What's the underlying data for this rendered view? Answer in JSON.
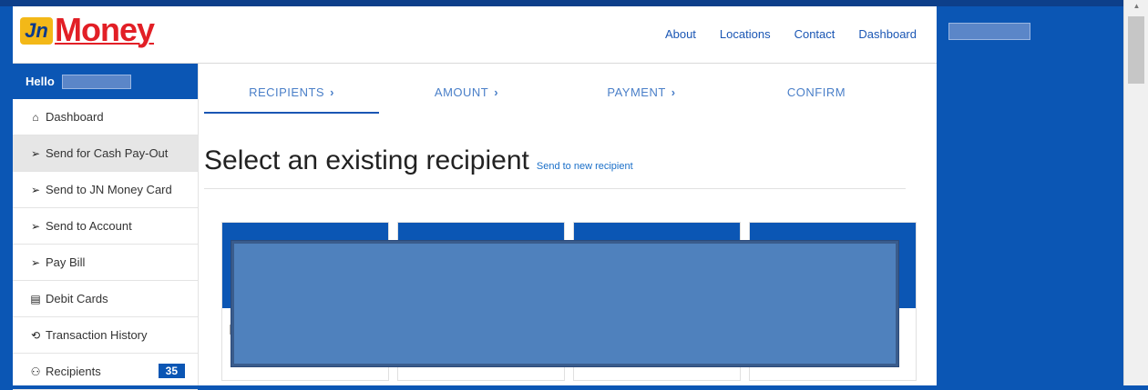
{
  "brand": {
    "logo_mark": "Jn",
    "logo_text": "Money"
  },
  "topnav": [
    "About",
    "Locations",
    "Contact",
    "Dashboard"
  ],
  "sidebar": {
    "greeting": "Hello",
    "items": [
      {
        "icon": "home-icon",
        "glyph": "🏠",
        "label": "Dashboard"
      },
      {
        "icon": "send-arrow-icon",
        "glyph": "➢",
        "label": "Send for Cash Pay-Out",
        "active": true
      },
      {
        "icon": "send-arrow-icon",
        "glyph": "➢",
        "label": "Send to JN Money Card"
      },
      {
        "icon": "send-arrow-icon",
        "glyph": "➢",
        "label": "Send to Account"
      },
      {
        "icon": "send-arrow-icon",
        "glyph": "➢",
        "label": "Pay Bill"
      },
      {
        "icon": "card-icon",
        "glyph": "▤",
        "label": "Debit Cards"
      },
      {
        "icon": "history-icon",
        "glyph": "⟲",
        "label": "Transaction History"
      },
      {
        "icon": "people-icon",
        "glyph": "👥",
        "label": "Recipients",
        "badge": "35"
      }
    ]
  },
  "steps": [
    {
      "label": "RECIPIENTS",
      "chevron": "›",
      "active": true
    },
    {
      "label": "AMOUNT",
      "chevron": "›"
    },
    {
      "label": "PAYMENT",
      "chevron": "›"
    },
    {
      "label": "CONFIRM",
      "chevron": ""
    }
  ],
  "main": {
    "title": "Select an existing recipient",
    "new_recipient_link": "Send to new recipient"
  },
  "colors": {
    "brand_blue": "#0b56b4",
    "logo_red": "#e21f26",
    "logo_yellow": "#f3b818"
  }
}
